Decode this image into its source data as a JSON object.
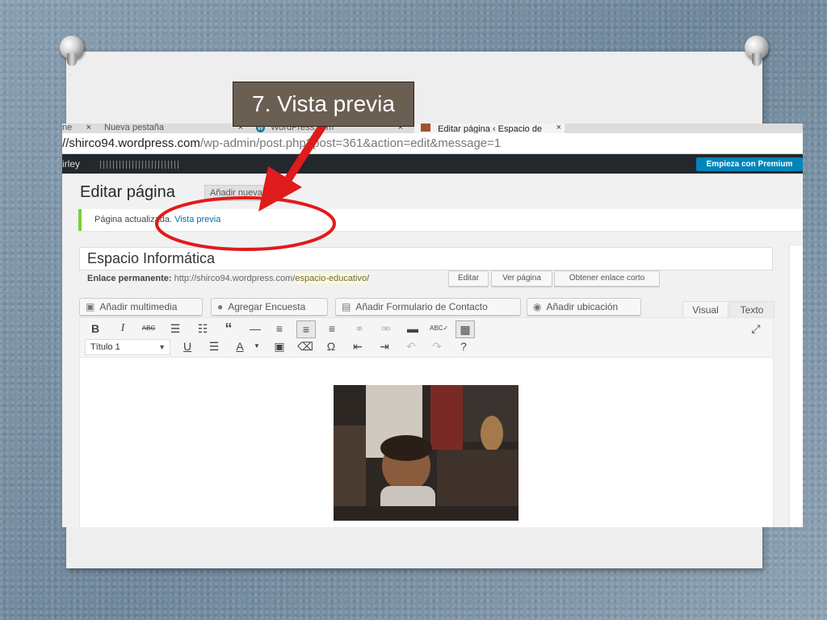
{
  "slide": {
    "callout": "7. Vista previa",
    "colors": {
      "arrow": "#e01b1b",
      "circle": "#e01b1b",
      "callout_bg": "#6b5e52"
    }
  },
  "browser": {
    "tabs": [
      {
        "label": "ne",
        "close": "×"
      },
      {
        "label": "Nueva pestaña",
        "close": "×"
      },
      {
        "label": "WordPress.com",
        "close": "×",
        "icon": "wordpress-icon"
      },
      {
        "label": "Editar página ‹ Espacio de",
        "close": "×"
      }
    ],
    "url_host": "//shirco94.wordpress.com",
    "url_path": "/wp-admin/post.php?post=361&action=edit&message=1"
  },
  "adminbar": {
    "site": "irley",
    "premium_label": "Empieza con Premium"
  },
  "page": {
    "heading": "Editar página",
    "add_new": "Añadir nueva",
    "notice_text": "Página actualizada.",
    "notice_link": "Vista previa",
    "post_title": "Espacio Informática",
    "permalink_label": "Enlace permanente:",
    "permalink_base": "http://shirco94.wordpress.com/",
    "permalink_slug": "espacio-educativo",
    "permalink_end": "/",
    "edit_btn": "Editar",
    "view_btn": "Ver página",
    "shortlink_btn": "Obtener enlace corto"
  },
  "media_buttons": [
    {
      "label": "Añadir multimedia",
      "icon": "media-icon"
    },
    {
      "label": "Agregar Encuesta",
      "icon": "poll-icon"
    },
    {
      "label": "Añadir Formulario de Contacto",
      "icon": "form-icon"
    },
    {
      "label": "Añadir ubicación",
      "icon": "location-icon"
    }
  ],
  "editor_tabs": {
    "visual": "Visual",
    "text": "Texto"
  },
  "toolbar": {
    "format_select": "Título 1",
    "caret": "▼"
  }
}
